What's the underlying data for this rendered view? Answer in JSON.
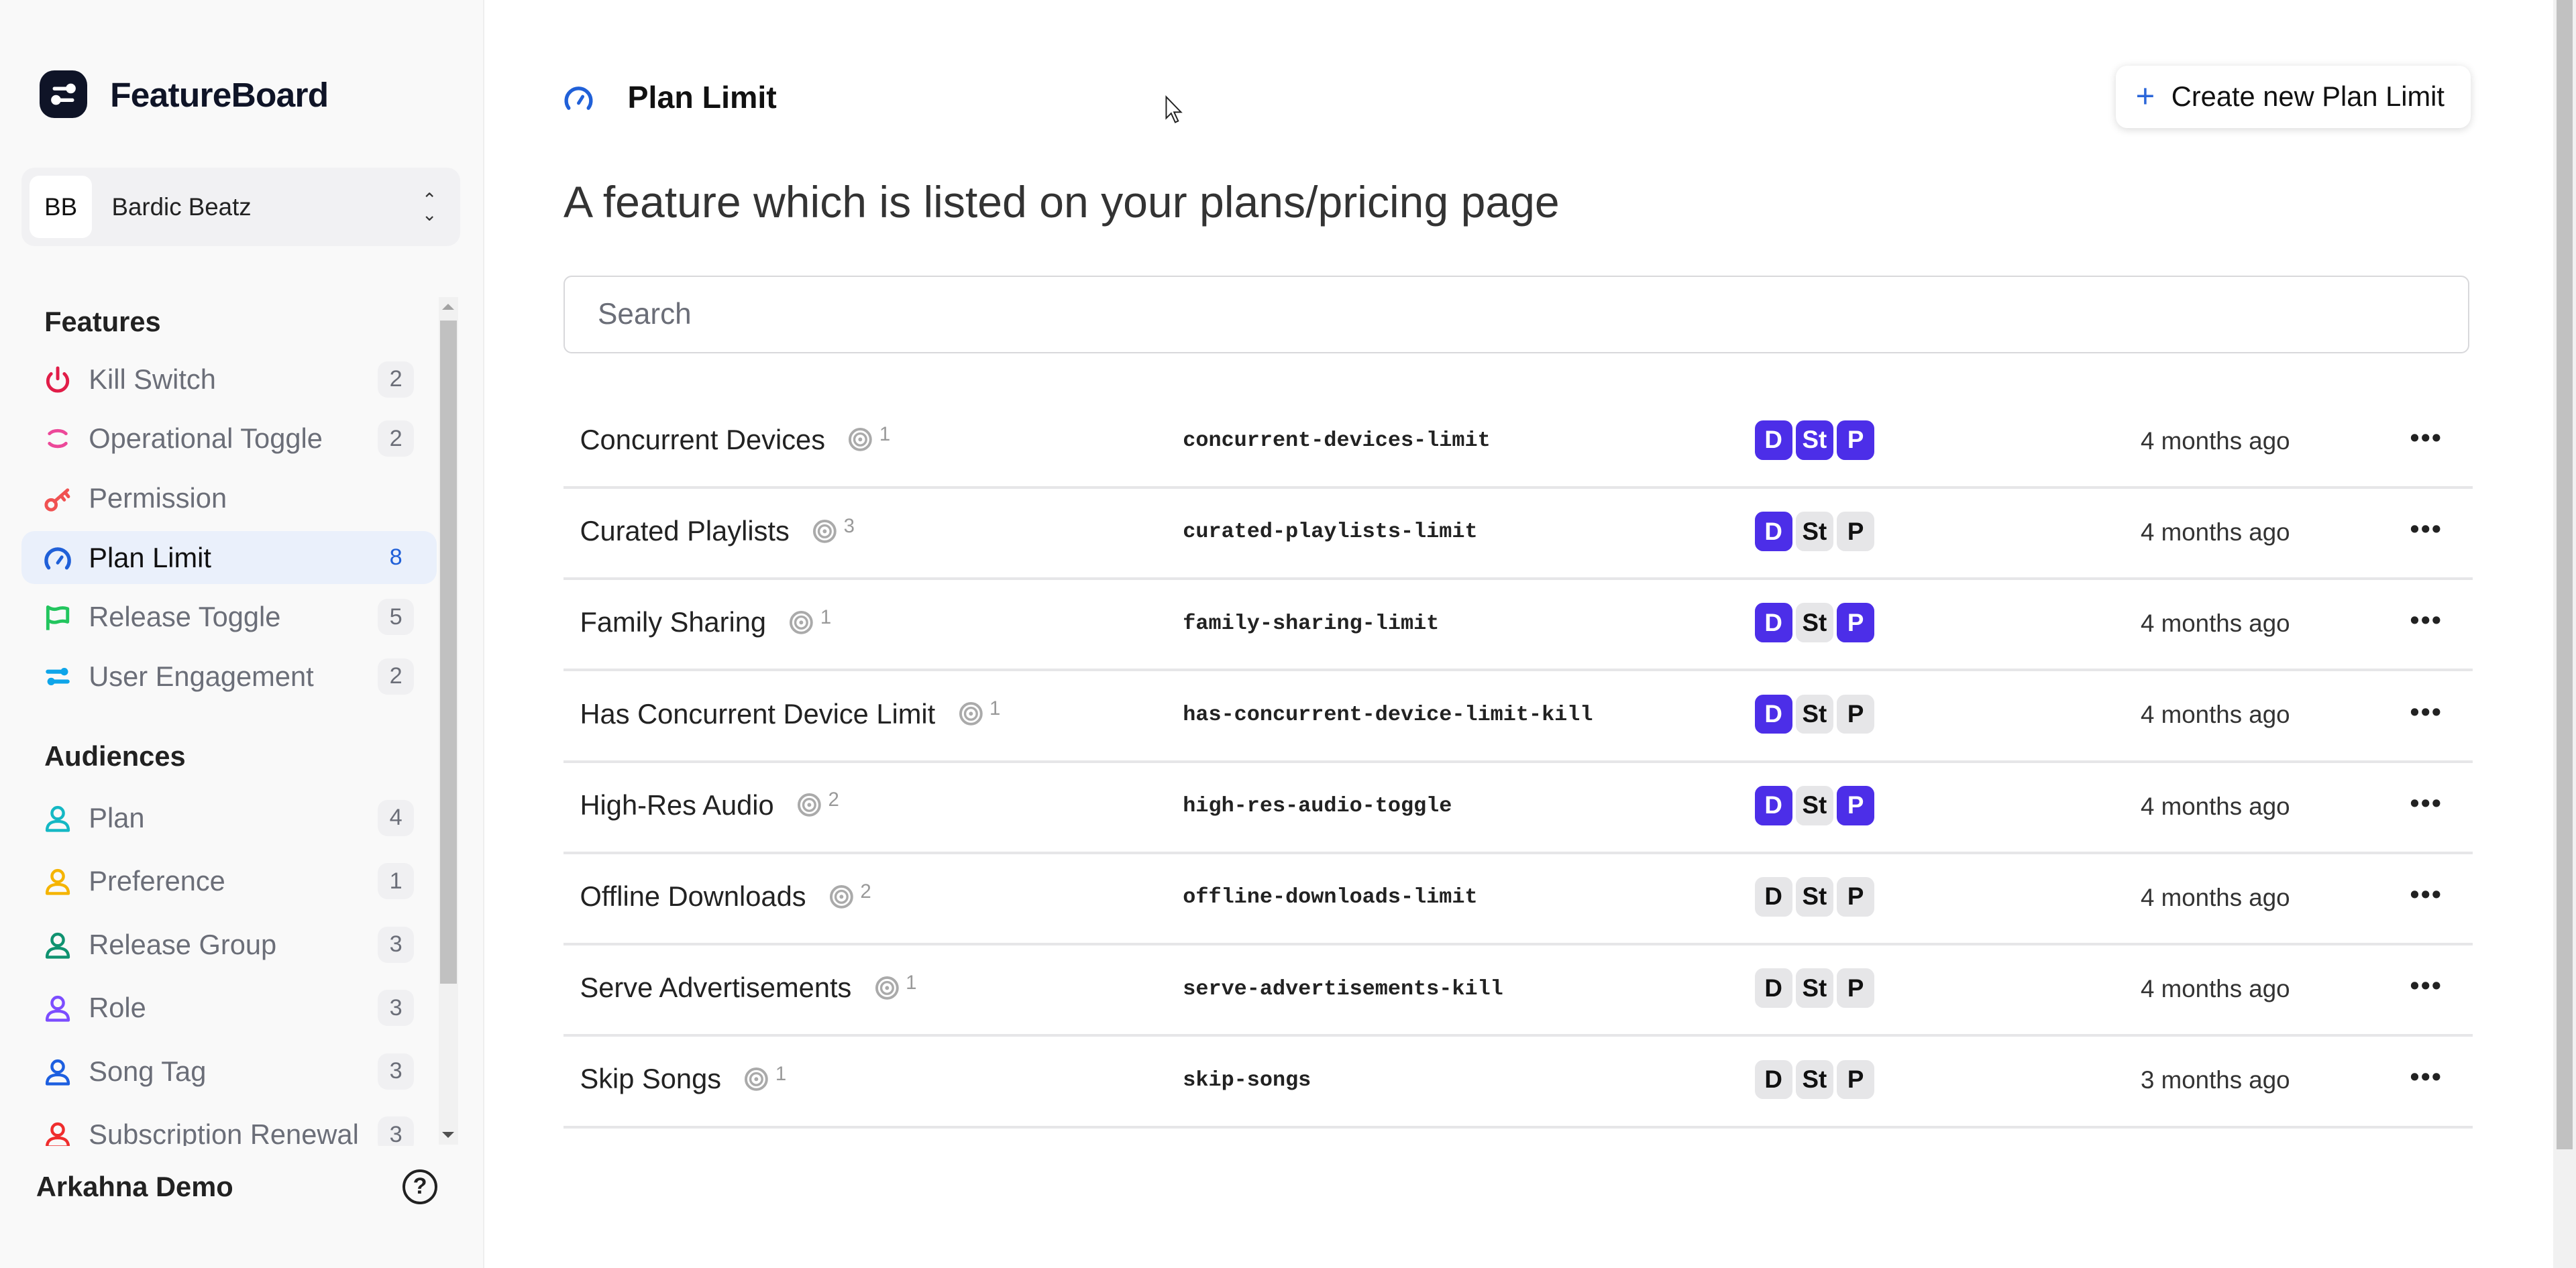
{
  "brand": {
    "name": "FeatureBoard"
  },
  "org": {
    "initials": "BB",
    "name": "Bardic Beatz"
  },
  "sidebar": {
    "features_title": "Features",
    "features": [
      {
        "label": "Kill Switch",
        "count": "2",
        "icon": "power-icon",
        "color": "#e11d48"
      },
      {
        "label": "Operational Toggle",
        "count": "2",
        "icon": "operational-toggle-icon",
        "color": "#ec4899"
      },
      {
        "label": "Permission",
        "count": "",
        "icon": "key-icon",
        "color": "#f05252"
      },
      {
        "label": "Plan Limit",
        "count": "8",
        "icon": "gauge-icon",
        "color": "#2060d8",
        "active": true
      },
      {
        "label": "Release Toggle",
        "count": "5",
        "icon": "flag-icon",
        "color": "#22c55e"
      },
      {
        "label": "User Engagement",
        "count": "2",
        "icon": "sliders-icon",
        "color": "#0ea5e9"
      }
    ],
    "audiences_title": "Audiences",
    "audiences": [
      {
        "label": "Plan",
        "count": "4",
        "color": "#14b8c4"
      },
      {
        "label": "Preference",
        "count": "1",
        "color": "#f5b400"
      },
      {
        "label": "Release Group",
        "count": "3",
        "color": "#0f9270"
      },
      {
        "label": "Role",
        "count": "3",
        "color": "#7c4dff"
      },
      {
        "label": "Song Tag",
        "count": "3",
        "color": "#1d5fe0"
      },
      {
        "label": "Subscription Renewal",
        "count": "3",
        "color": "#ef2d2d"
      }
    ],
    "footer_name": "Arkahna Demo",
    "help_label": "?"
  },
  "header": {
    "title": "Plan Limit",
    "create_label": "Create new Plan Limit",
    "subtitle": "A feature which is listed on your plans/pricing page"
  },
  "search": {
    "placeholder": "Search",
    "value": ""
  },
  "rows": [
    {
      "name": "Concurrent Devices",
      "refs": "1",
      "key": "concurrent-devices-limit",
      "envs": {
        "D": true,
        "S": true,
        "P": true
      },
      "updated": "4 months ago"
    },
    {
      "name": "Curated Playlists",
      "refs": "3",
      "key": "curated-playlists-limit",
      "envs": {
        "D": true,
        "S": false,
        "P": false
      },
      "updated": "4 months ago"
    },
    {
      "name": "Family Sharing",
      "refs": "1",
      "key": "family-sharing-limit",
      "envs": {
        "D": true,
        "S": false,
        "P": true
      },
      "updated": "4 months ago"
    },
    {
      "name": "Has Concurrent Device Limit",
      "refs": "1",
      "key": "has-concurrent-device-limit-kill",
      "envs": {
        "D": true,
        "S": false,
        "P": false
      },
      "updated": "4 months ago"
    },
    {
      "name": "High-Res Audio",
      "refs": "2",
      "key": "high-res-audio-toggle",
      "envs": {
        "D": true,
        "S": false,
        "P": true
      },
      "updated": "4 months ago"
    },
    {
      "name": "Offline Downloads",
      "refs": "2",
      "key": "offline-downloads-limit",
      "envs": {
        "D": false,
        "S": false,
        "P": false
      },
      "updated": "4 months ago"
    },
    {
      "name": "Serve Advertisements",
      "refs": "1",
      "key": "serve-advertisements-kill",
      "envs": {
        "D": false,
        "S": false,
        "P": false
      },
      "updated": "4 months ago"
    },
    {
      "name": "Skip Songs",
      "refs": "1",
      "key": "skip-songs",
      "envs": {
        "D": false,
        "S": false,
        "P": false
      },
      "updated": "3 months ago"
    }
  ],
  "env_labels": [
    "D",
    "St",
    "P"
  ],
  "colors": {
    "accent": "#4c2ee8",
    "active_nav": "#2060d8",
    "env_off": "#e6e6e8"
  }
}
